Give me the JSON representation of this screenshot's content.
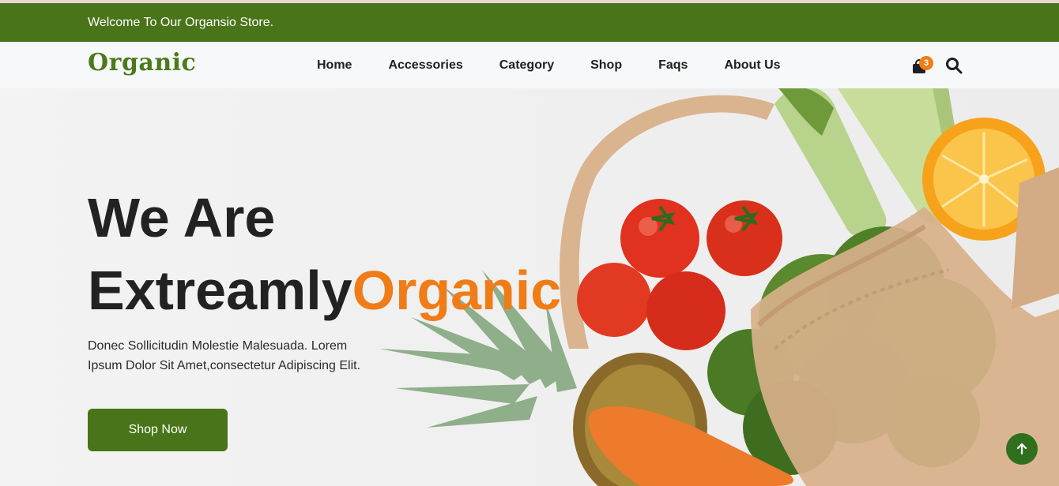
{
  "topbar": {
    "welcome": "Welcome To Our Organsio Store."
  },
  "header": {
    "logo": "Organic",
    "nav": [
      "Home",
      "Accessories",
      "Category",
      "Shop",
      "Faqs",
      "About Us"
    ],
    "cart_count": "3",
    "icons": {
      "cart": "shopping-bag-icon",
      "search": "search-icon"
    }
  },
  "hero": {
    "title_line1": "We Are",
    "title_line2": "Extreamly",
    "title_accent": "Organic",
    "description": "Donec Sollicitudin Molestie Malesuada. Lorem Ipsum Dolor Sit Amet,consectetur Adipiscing Elit.",
    "cta": "Shop Now"
  },
  "colors": {
    "brand_green": "#497419",
    "accent_orange": "#f07c17",
    "scroll_button": "#2f6f1e"
  },
  "scroll_top_icon": "arrow-up-icon"
}
